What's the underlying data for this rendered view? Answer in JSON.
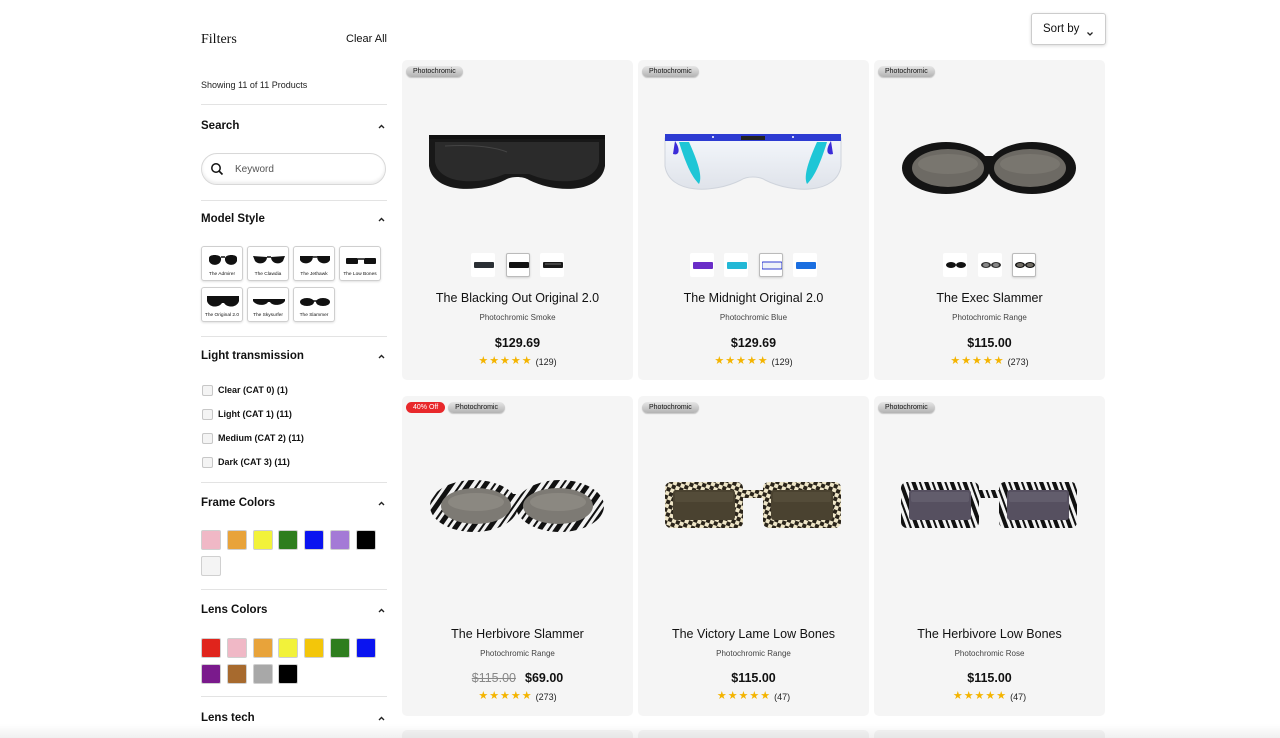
{
  "filters": {
    "title": "Filters",
    "clear_all": "Clear All",
    "showing": "Showing 11 of 11 Products"
  },
  "search": {
    "title": "Search",
    "placeholder": "Keyword"
  },
  "model_style": {
    "title": "Model Style",
    "items": [
      "The Admirer",
      "The Clawdia",
      "The Jethawk",
      "The Low Bones",
      "The Original 2.0",
      "The Skysurfer",
      "The Slammer"
    ]
  },
  "light_transmission": {
    "title": "Light transmission",
    "options": [
      "Clear (CAT 0) (1)",
      "Light (CAT 1) (11)",
      "Medium (CAT 2) (11)",
      "Dark (CAT 3) (11)"
    ]
  },
  "frame_colors": {
    "title": "Frame Colors",
    "swatches": [
      "#f0b8c6",
      "#e8a33a",
      "#f2f23a",
      "#2e7d1e",
      "#0a14f0",
      "#a47ad6",
      "#000000",
      "#f4f4f4"
    ]
  },
  "lens_colors": {
    "title": "Lens Colors",
    "swatches": [
      "#e0241c",
      "#f0b8c6",
      "#e8a33a",
      "#f2f23a",
      "#f3c60a",
      "#2e7d1e",
      "#0a14f0",
      "#7a1a8c",
      "#a76a2e",
      "#a8a8a8",
      "#000000"
    ]
  },
  "lens_tech": {
    "title": "Lens tech"
  },
  "sort": {
    "label": "Sort by"
  },
  "products": [
    {
      "name": "The Blacking Out Original 2.0",
      "lens": "Photochromic Smoke",
      "price": "$129.69",
      "old_price": "",
      "rating_count": "(129)",
      "badges": [
        "Photochromic"
      ]
    },
    {
      "name": "The Midnight Original 2.0",
      "lens": "Photochromic Blue",
      "price": "$129.69",
      "old_price": "",
      "rating_count": "(129)",
      "badges": [
        "Photochromic"
      ]
    },
    {
      "name": "The Exec Slammer",
      "lens": "Photochromic Range",
      "price": "$115.00",
      "old_price": "",
      "rating_count": "(273)",
      "badges": [
        "Photochromic"
      ]
    },
    {
      "name": "The Herbivore Slammer",
      "lens": "Photochromic Range",
      "price": "$69.00",
      "old_price": "$115.00",
      "rating_count": "(273)",
      "badges": [
        "40% Off",
        "Photochromic"
      ]
    },
    {
      "name": "The Victory Lame Low Bones",
      "lens": "Photochromic Range",
      "price": "$115.00",
      "old_price": "",
      "rating_count": "(47)",
      "badges": [
        "Photochromic"
      ]
    },
    {
      "name": "The Herbivore Low Bones",
      "lens": "Photochromic Rose",
      "price": "$115.00",
      "old_price": "",
      "rating_count": "(47)",
      "badges": [
        "Photochromic"
      ]
    }
  ],
  "rating_stars": "★★★★★",
  "colors": {
    "star": "#f4b400",
    "sale_badge": "#e8282b",
    "card_bg": "#f5f5f5"
  }
}
